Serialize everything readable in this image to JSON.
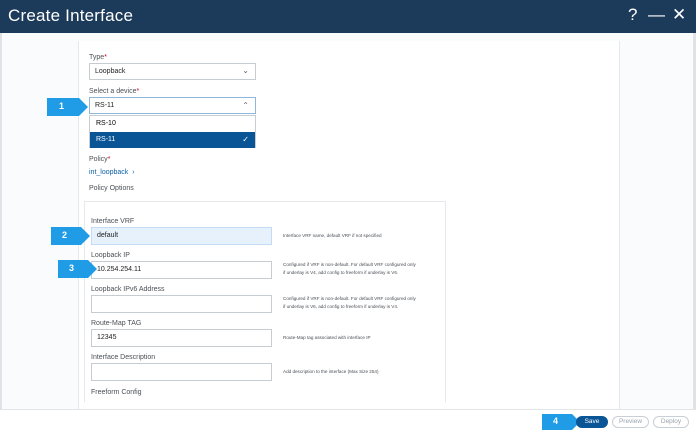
{
  "window": {
    "title": "Create Interface",
    "help_symbol": "?",
    "minimize_symbol": "—",
    "close_symbol": "✕"
  },
  "form": {
    "type": {
      "label": "Type",
      "required_mark": "*",
      "value": "Loopback"
    },
    "device": {
      "label": "Select a device",
      "required_mark": "*",
      "value": "RS-11",
      "options": [
        {
          "label": "RS-10",
          "selected": false
        },
        {
          "label": "RS-11",
          "selected": true
        }
      ]
    },
    "policy": {
      "label": "Policy",
      "required_mark": "*",
      "value": "int_loopback"
    },
    "policy_options_label": "Policy Options",
    "fields": {
      "interface_vrf": {
        "label": "Interface VRF",
        "value": "default",
        "help": "Interface VRF name, default VRF if not specified"
      },
      "loopback_ip": {
        "label": "Loopback IP",
        "value": "10.254.254.11",
        "help_line1": "Configured if VRF is non-default. For default VRF configured only",
        "help_line2": "if underlay is V4, add config to freeform if underlay is V6."
      },
      "loopback_ipv6": {
        "label": "Loopback IPv6 Address",
        "value": "",
        "help_line1": "Configured if VRF is non-default. For default VRF configured only",
        "help_line2": "if underlay is V6, add config to freeform if underlay is V4."
      },
      "route_map_tag": {
        "label": "Route-Map TAG",
        "value": "12345",
        "help": "Route-Map tag associated with interface IP"
      },
      "interface_description": {
        "label": "Interface Description",
        "value": "",
        "help": "Add description to the interface (Max Size 254)"
      },
      "freeform_config": {
        "label": "Freeform Config"
      }
    }
  },
  "callouts": [
    "1",
    "2",
    "3",
    "4"
  ],
  "footer": {
    "save": "Save",
    "preview": "Preview",
    "deploy": "Deploy"
  },
  "colors": {
    "titlebar": "#1c3a5a",
    "accent": "#0a5596",
    "callout": "#1f9ce5",
    "filled_input": "#e6f1fc"
  }
}
